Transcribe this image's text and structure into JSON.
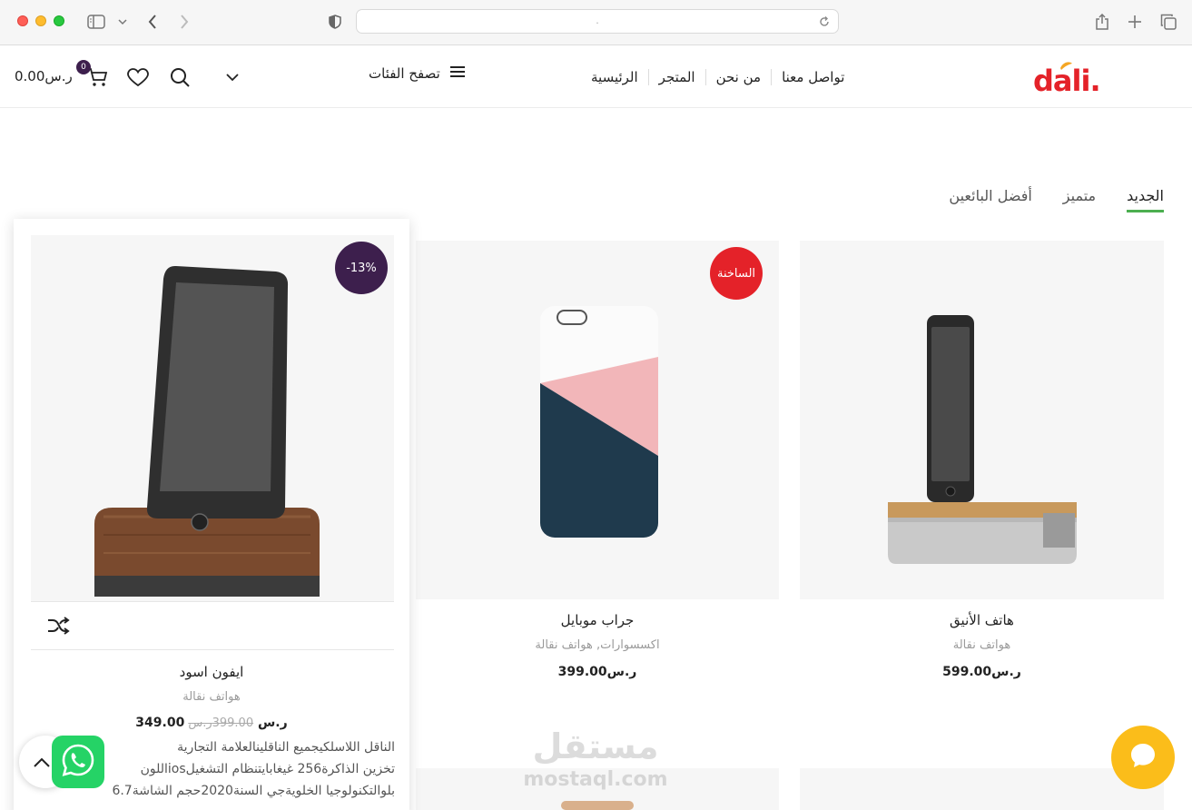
{
  "browser": {
    "address": "."
  },
  "header": {
    "logo_text": "dali.",
    "nav": [
      "الرئيسية",
      "المتجر",
      "من نحن",
      "تواصل معنا"
    ],
    "categories_label": "تصفح الفئات",
    "cart_total": "0.00ر.س",
    "cart_count": "0"
  },
  "tabs": [
    {
      "label": "الجديد",
      "active": true
    },
    {
      "label": "متميز",
      "active": false
    },
    {
      "label": "أفضل البائعين",
      "active": false
    }
  ],
  "products": [
    {
      "title": "هاتف الأنيق",
      "categories": "هواتف نقالة",
      "price": "599.00ر.س"
    },
    {
      "title": "جراب موبايل",
      "categories": "اكسسوارات, هواتف نقالة",
      "price": "399.00ر.س",
      "badge": "الساخنة",
      "badge_color": "#e42229"
    },
    {
      "title": "ايفون اسود",
      "categories": "هواتف نقالة",
      "price": "349.00ر.س",
      "old_price": "399.00ر.س",
      "badge": "-13%",
      "badge_color": "#3d1f4d",
      "description": [
        "الناقل اللاسلكيجميع الناقلينالعلامة التجارية",
        "تخزين الذاكرة256 غيغابايتنظام التشغيلiosاللون",
        "بلوالتكنولوجيا الخلويةجي السنة2020حجم الشاشة6.7"
      ]
    }
  ],
  "watermark": {
    "arabic": "مستقل",
    "latin": "mostaql.com"
  },
  "colors": {
    "accent_green": "#4caf50",
    "brand_red": "#e42229",
    "badge_purple": "#3d1f4d",
    "chat_yellow": "#fbbd1a",
    "whatsapp_green": "#25d366"
  }
}
